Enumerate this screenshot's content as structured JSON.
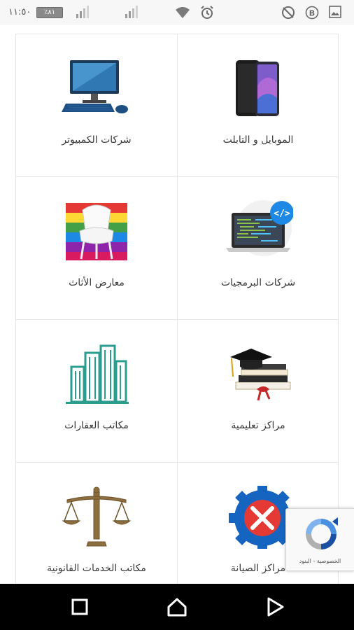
{
  "status_bar": {
    "time": "١١:٥٠",
    "battery": "٪٨١",
    "icons": [
      "signal-icon",
      "signal-icon",
      "wifi-icon",
      "alarm-icon",
      "data-saver-off-icon",
      "b-icon",
      "image-icon"
    ]
  },
  "categories": [
    {
      "label": "الموبايل و التابلت",
      "icon": "smartphones-icon"
    },
    {
      "label": "شركات الكمبيوتر",
      "icon": "desktop-computer-icon"
    },
    {
      "label": "شركات البرمجيات",
      "icon": "laptop-code-icon"
    },
    {
      "label": "معارض الأثاث",
      "icon": "furniture-icon"
    },
    {
      "label": "مراكز تعليمية",
      "icon": "graduation-books-icon"
    },
    {
      "label": "مكاتب العقارات",
      "icon": "buildings-icon"
    },
    {
      "label": "مراكز الصيانة",
      "icon": "maintenance-gear-icon"
    },
    {
      "label": "مكاتب الخدمات القانونية",
      "icon": "justice-scales-icon"
    }
  ],
  "recaptcha": {
    "links": "الخصوصية - البنود",
    "icon": "recaptcha-icon"
  },
  "nav_bar": {
    "buttons": [
      "recents-button",
      "home-button",
      "back-button"
    ]
  },
  "colors": {
    "status_bar_bg": "#f7f7f7",
    "nav_bar_bg": "#000000",
    "grid_line": "#e6e6e6",
    "label_text": "#3a3a3a"
  }
}
